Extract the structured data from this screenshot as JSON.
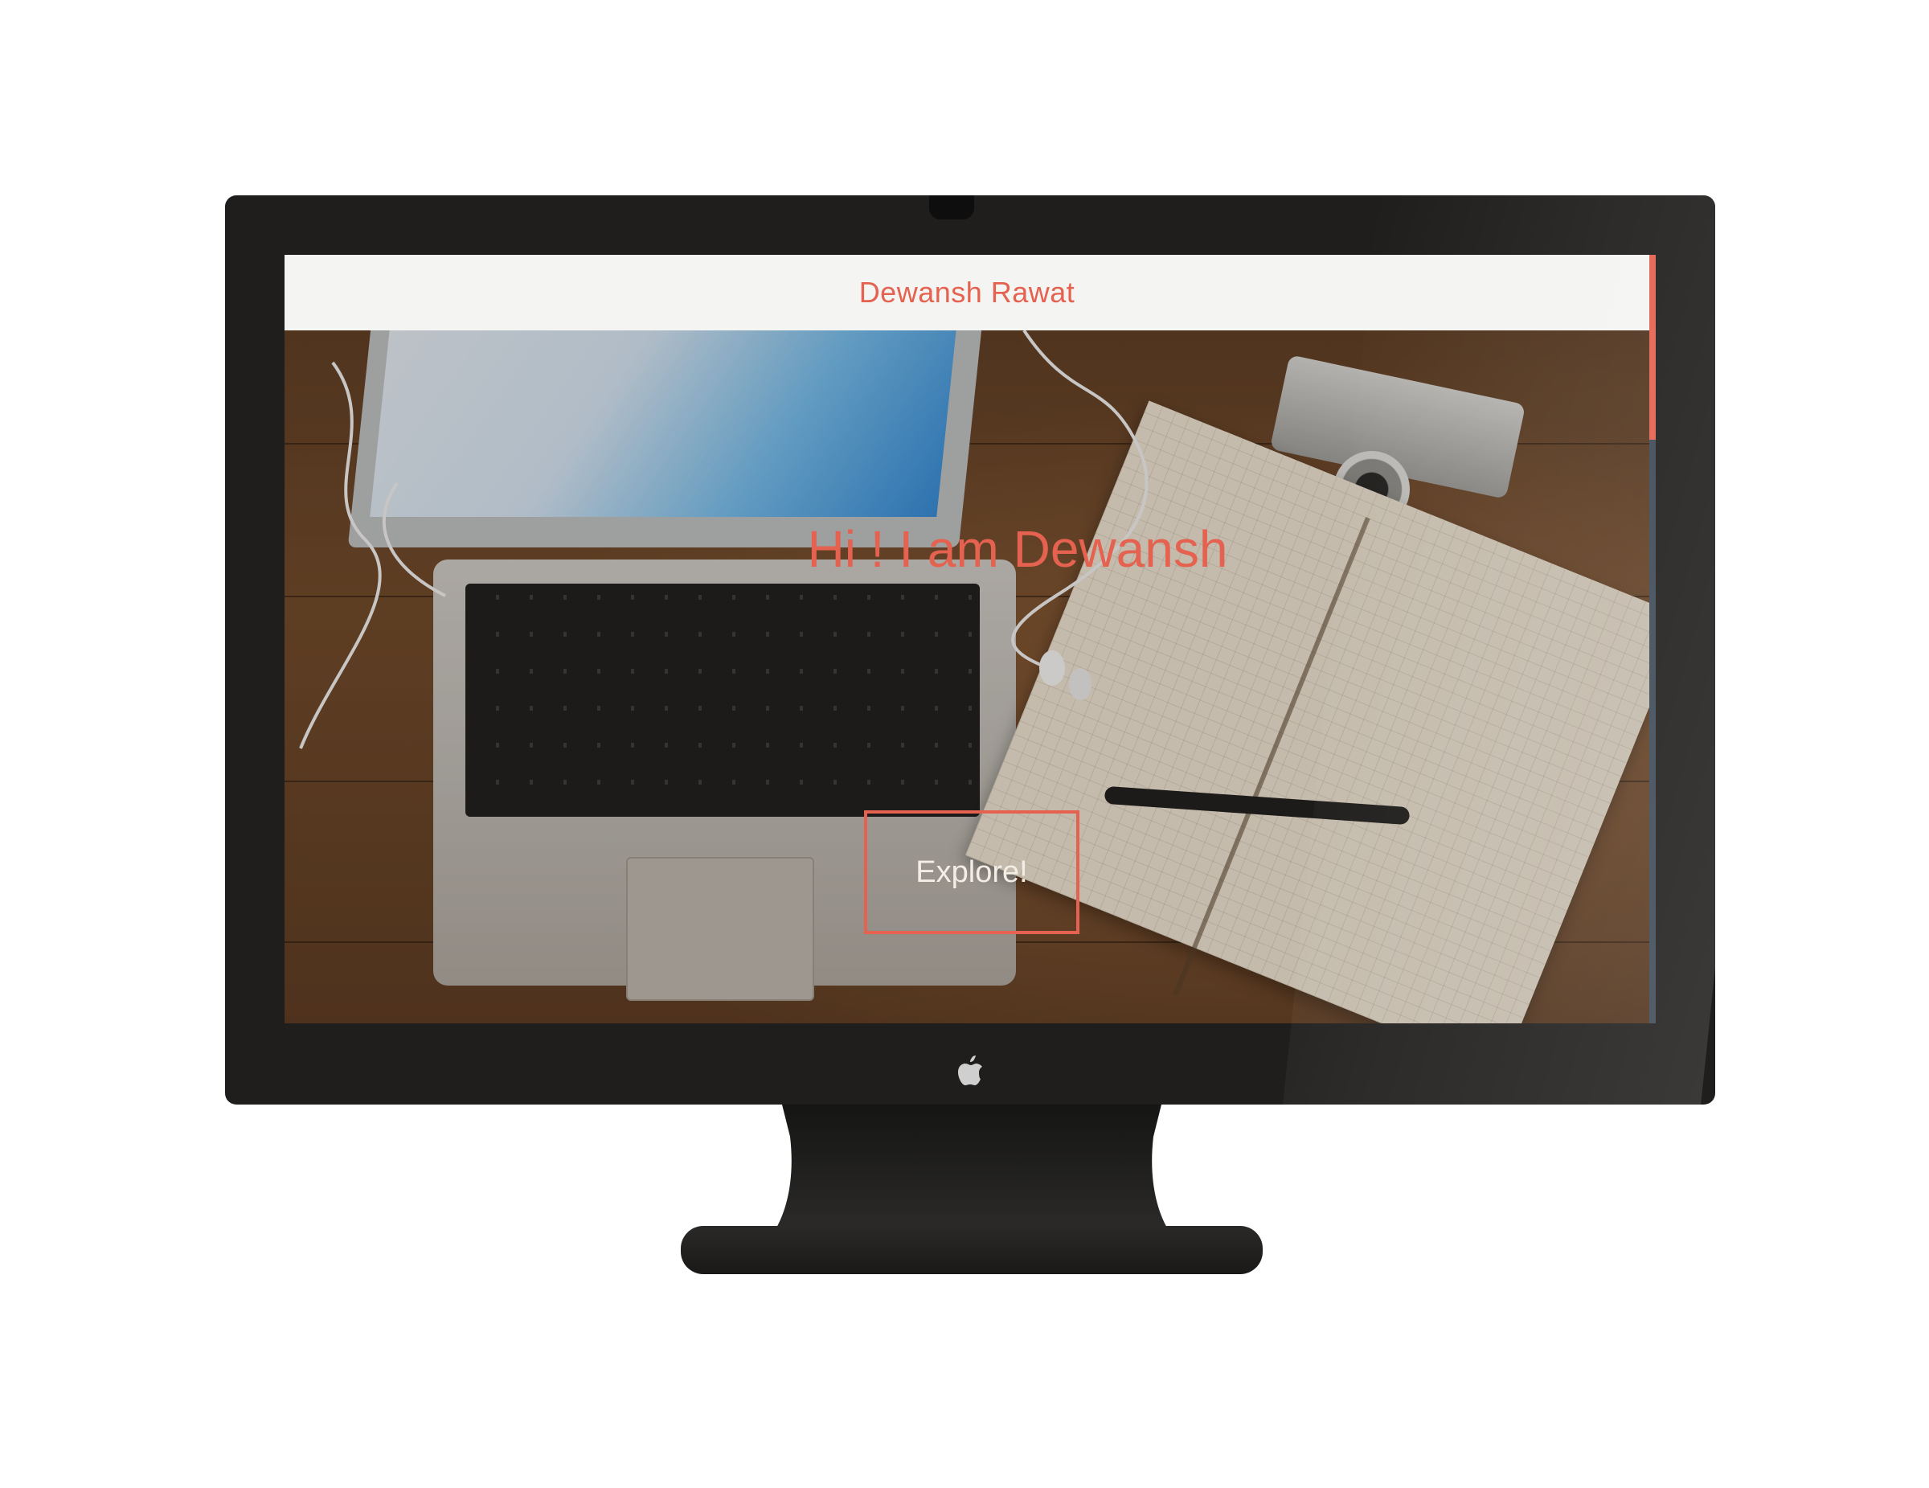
{
  "header": {
    "site_title": "Dewansh Rawat"
  },
  "hero": {
    "heading": "Hi ! I am Dewansh",
    "cta_label": "Explore!"
  },
  "colors": {
    "accent": "#e4624f",
    "navbar_bg": "#f4f4f2",
    "bezel": "#1f1e1d",
    "scroll_track": "#3d4a57"
  },
  "scrollbar": {
    "position_fraction": 0.0
  },
  "icons": {
    "device_logo": "apple-logo-icon"
  }
}
